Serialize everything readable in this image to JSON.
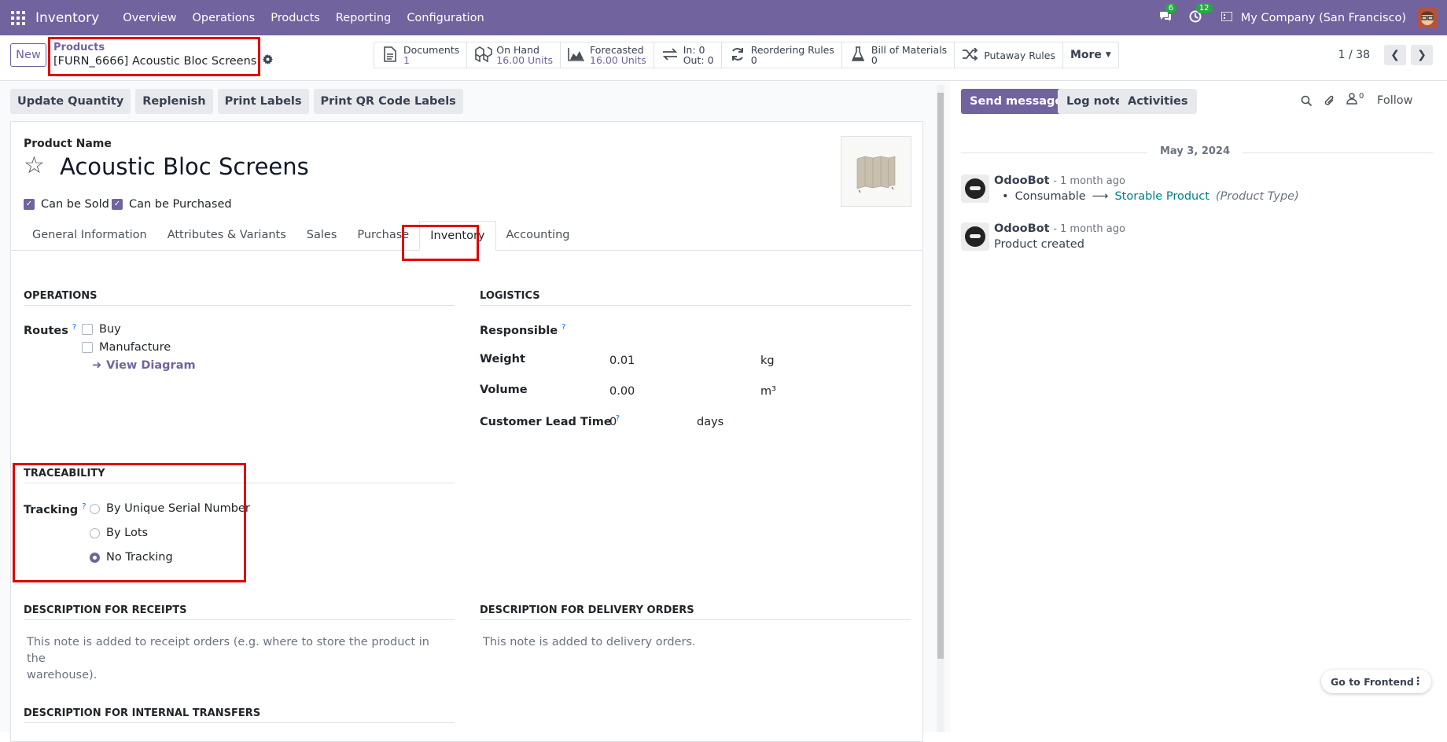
{
  "topbar": {
    "app_name": "Inventory",
    "menu": [
      "Overview",
      "Operations",
      "Products",
      "Reporting",
      "Configuration"
    ],
    "chat_badge": "6",
    "activity_badge": "12",
    "company": "My Company (San Francisco)"
  },
  "control": {
    "new_label": "New",
    "breadcrumb_parent": "Products",
    "record_name": "[FURN_6666] Acoustic Bloc Screens",
    "smart_buttons": [
      {
        "label": "Documents",
        "value": "1"
      },
      {
        "label": "On Hand",
        "value": "16.00 Units"
      },
      {
        "label": "Forecasted",
        "value": "16.00 Units"
      },
      {
        "label": "In: 0",
        "value": "Out: 0"
      },
      {
        "label": "Reordering Rules",
        "value": "0"
      },
      {
        "label": "Bill of Materials",
        "value": "0"
      },
      {
        "label": "Putaway Rules",
        "value": ""
      }
    ],
    "more_label": "More",
    "pager": "1 / 38"
  },
  "actions": [
    "Update Quantity",
    "Replenish",
    "Print Labels",
    "Print QR Code Labels"
  ],
  "form": {
    "product_name_label": "Product Name",
    "product_name": "Acoustic Bloc Screens",
    "can_be_sold": "Can be Sold",
    "can_be_purchased": "Can be Purchased",
    "tabs": [
      "General Information",
      "Attributes & Variants",
      "Sales",
      "Purchase",
      "Inventory",
      "Accounting"
    ],
    "active_tab": "Inventory",
    "operations": {
      "title": "OPERATIONS",
      "routes_label": "Routes",
      "routes": [
        "Buy",
        "Manufacture"
      ],
      "view_diagram": "View Diagram"
    },
    "logistics": {
      "title": "LOGISTICS",
      "responsible_label": "Responsible",
      "weight_label": "Weight",
      "weight_value": "0.01",
      "weight_unit": "kg",
      "volume_label": "Volume",
      "volume_value": "0.00",
      "volume_unit": "m³",
      "lead_label": "Customer Lead Time",
      "lead_value": "0",
      "lead_unit": "days"
    },
    "traceability": {
      "title": "TRACEABILITY",
      "tracking_label": "Tracking",
      "options": [
        "By Unique Serial Number",
        "By Lots",
        "No Tracking"
      ],
      "selected": "No Tracking"
    },
    "desc_receipts": {
      "title": "DESCRIPTION FOR RECEIPTS",
      "placeholder_l1": "This note is added to receipt orders (e.g. where to store the product in the",
      "placeholder_l2": "warehouse)."
    },
    "desc_delivery": {
      "title": "DESCRIPTION FOR DELIVERY ORDERS",
      "placeholder": "This note is added to delivery orders."
    },
    "desc_internal": {
      "title": "DESCRIPTION FOR INTERNAL TRANSFERS"
    }
  },
  "chatter": {
    "send_message": "Send message",
    "log_note": "Log note",
    "activities": "Activities",
    "followers_count": "0",
    "follow": "Follow",
    "date": "May 3, 2024",
    "messages": [
      {
        "author": "OdooBot",
        "when": "- 1 month ago",
        "old": "Consumable",
        "new": "Storable Product",
        "field": "(Product Type)"
      },
      {
        "author": "OdooBot",
        "when": "- 1 month ago",
        "body": "Product created"
      }
    ],
    "go_frontend": "Go to Frontend"
  },
  "colors": {
    "brand": "#71639e",
    "highlight": "#e00000",
    "link": "#017e84"
  }
}
